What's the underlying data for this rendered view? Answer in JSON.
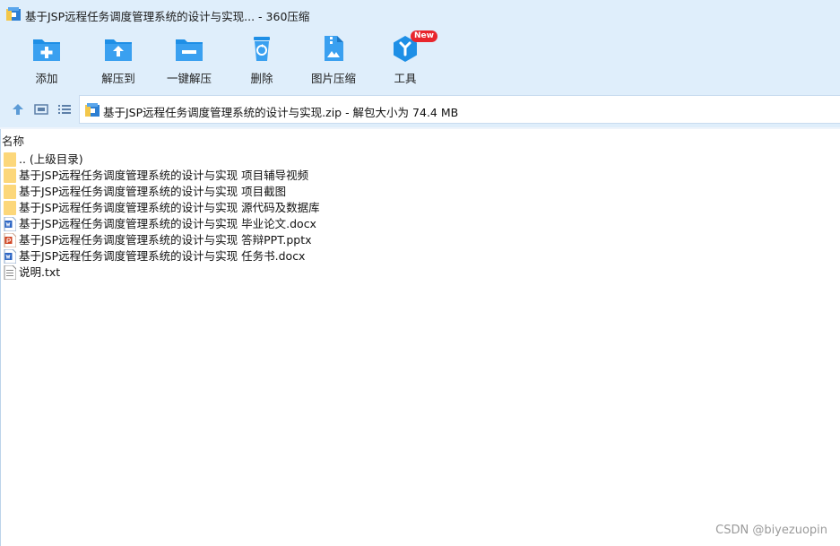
{
  "window": {
    "title": "基于JSP远程任务调度管理系统的设计与实现... - 360压缩"
  },
  "toolbar": {
    "items": [
      {
        "label": "添加",
        "icon": "folder-plus-icon"
      },
      {
        "label": "解压到",
        "icon": "folder-extract-icon"
      },
      {
        "label": "一键解压",
        "icon": "folder-minus-icon"
      },
      {
        "label": "删除",
        "icon": "recycle-bin-icon"
      },
      {
        "label": "图片压缩",
        "icon": "image-compress-icon"
      },
      {
        "label": "工具",
        "icon": "tools-hex-icon",
        "badge": "New"
      }
    ]
  },
  "address": {
    "text": "基于JSP远程任务调度管理系统的设计与实现.zip - 解包大小为 74.4 MB"
  },
  "list": {
    "header": "名称",
    "rows": [
      {
        "name": ".. (上级目录)",
        "type": "folder"
      },
      {
        "name": "基于JSP远程任务调度管理系统的设计与实现 项目辅导视频",
        "type": "folder"
      },
      {
        "name": "基于JSP远程任务调度管理系统的设计与实现 项目截图",
        "type": "folder"
      },
      {
        "name": "基于JSP远程任务调度管理系统的设计与实现 源代码及数据库",
        "type": "folder"
      },
      {
        "name": "基于JSP远程任务调度管理系统的设计与实现 毕业论文.docx",
        "type": "word"
      },
      {
        "name": "基于JSP远程任务调度管理系统的设计与实现 答辩PPT.pptx",
        "type": "ppt"
      },
      {
        "name": "基于JSP远程任务调度管理系统的设计与实现 任务书.docx",
        "type": "word"
      },
      {
        "name": "说明.txt",
        "type": "txt"
      }
    ]
  },
  "watermark": "CSDN @biyezuopin",
  "colors": {
    "chrome_bg": "#dfeefb",
    "icon_blue": "#1e8fe6",
    "folder_yellow": "#fcd77a",
    "badge_red": "#e8262d"
  }
}
